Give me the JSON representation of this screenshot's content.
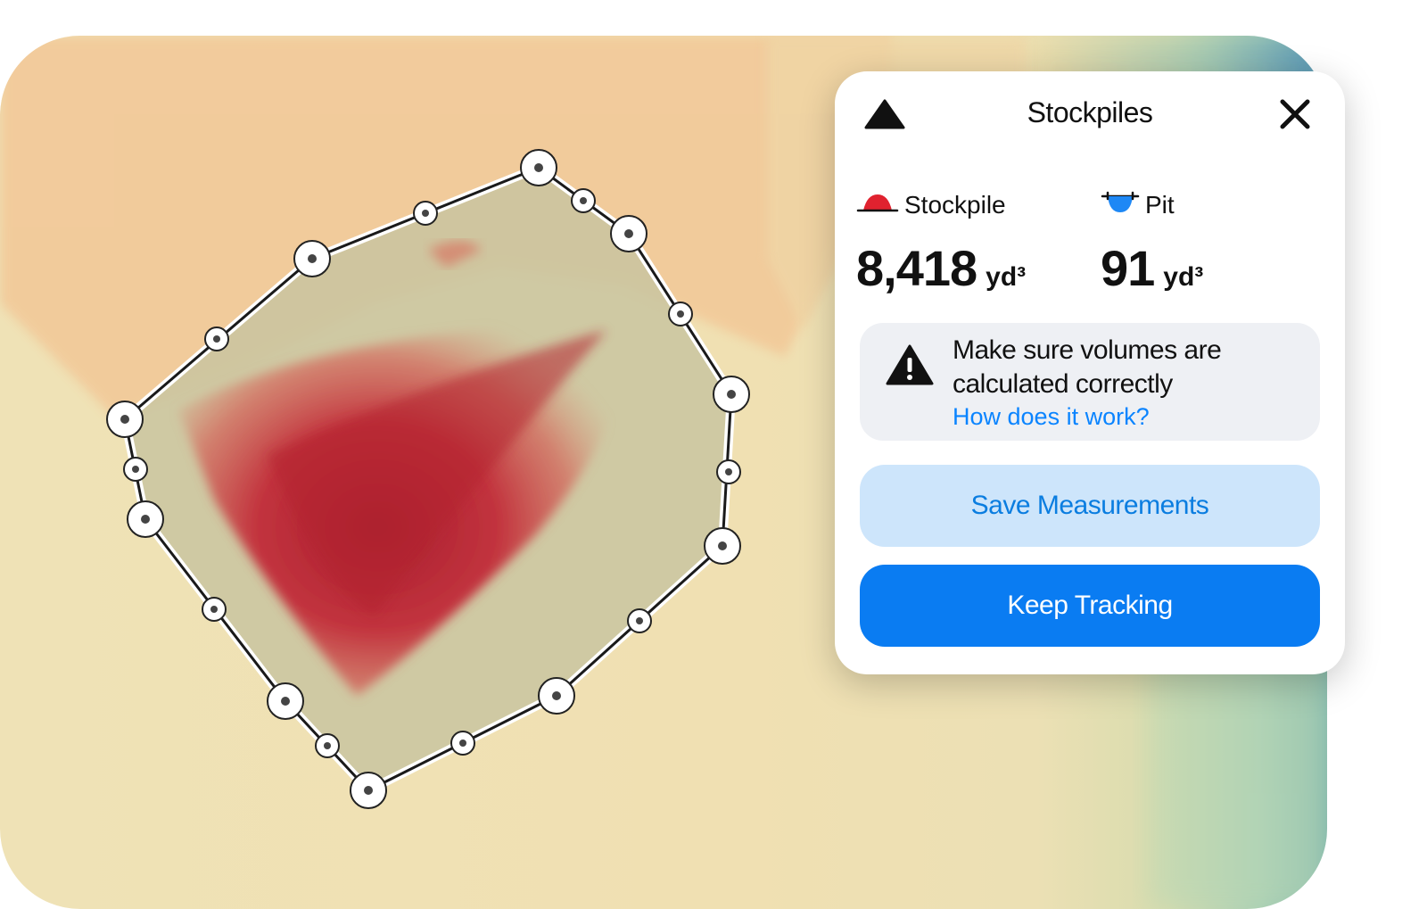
{
  "panel": {
    "title": "Stockpiles",
    "header_icon": "triangle-icon",
    "close_icon": "close-icon",
    "stockpile": {
      "label": "Stockpile",
      "value": "8,418",
      "unit": "yd³",
      "icon": "stockpile-mound-icon",
      "color": "#e0222f"
    },
    "pit": {
      "label": "Pit",
      "value": "91",
      "unit": "yd³",
      "icon": "pit-bowl-icon",
      "color": "#1e88f5"
    },
    "warning": {
      "icon": "warning-icon",
      "line1": "Make sure volumes are",
      "line2": "calculated correctly",
      "link": "How does it work?"
    },
    "save_button": "Save Measurements",
    "keep_button": "Keep Tracking"
  },
  "colors": {
    "accent": "#0a7cf2",
    "accent_light": "#cde5fb",
    "link": "#0a84ff"
  }
}
